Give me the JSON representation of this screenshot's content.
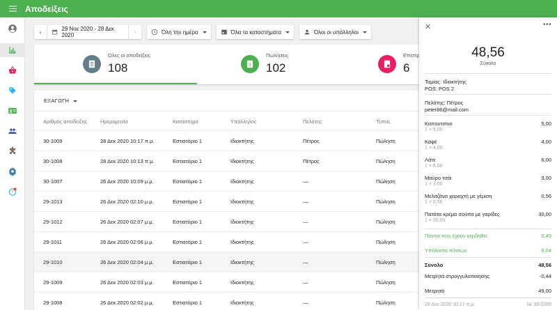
{
  "app": {
    "title": "Αποδείξεις"
  },
  "filters": {
    "date_range": "29 Νοε 2020 - 28 Δεκ 2020",
    "time": "Όλη την ημέρα",
    "stores": "Όλα τα καταστήματα",
    "employees": "Όλοι οι υπάλληλοι"
  },
  "summary": [
    {
      "label": "Όλες οι αποδείξεις",
      "value": "108",
      "color": "#607d8b"
    },
    {
      "label": "Πωλήσεις",
      "value": "102",
      "color": "#4caf50"
    },
    {
      "label": "Επιστρ",
      "value": "6",
      "color": "#e91e63"
    }
  ],
  "table": {
    "export_label": "ΕΞΑΓΩΓΗ",
    "headers": [
      "Αριθμός απόδειξης",
      "Ημερομηνία",
      "Κατάστημα",
      "Υπάλληλος",
      "Πελάτης",
      "Τύπος"
    ],
    "rows": [
      [
        "30-1009",
        "28 Δεκ 2020 10:17 π.μ.",
        "Εστιατόριο 1",
        "Ιδιοκτήτης",
        "Πέτρος",
        "Πώληση"
      ],
      [
        "30-1008",
        "28 Δεκ 2020 10:13 π.μ.",
        "Εστιατόριο 1",
        "Ιδιοκτήτης",
        "Πέτρος",
        "Πώληση"
      ],
      [
        "30-1007",
        "26 Δεκ 2020 10:09 μ.μ.",
        "Εστιατόριο 1",
        "Ιδιοκτήτης",
        "—",
        "Πώληση"
      ],
      [
        "29-1013",
        "26 Δεκ 2020 02:10 μ.μ.",
        "Εστιατόριο 1",
        "Ιδιοκτήτης",
        "—",
        "Πώληση"
      ],
      [
        "29-1012",
        "26 Δεκ 2020 02:07 μ.μ.",
        "Εστιατόριο 1",
        "Ιδιοκτήτης",
        "—",
        "Πώληση"
      ],
      [
        "29-1011",
        "26 Δεκ 2020 02:06 μ.μ.",
        "Εστιατόριο 1",
        "Ιδιοκτήτης",
        "—",
        "Πώληση"
      ],
      [
        "29-1010",
        "26 Δεκ 2020 02:04 μ.μ.",
        "Εστιατόριο 1",
        "Ιδιοκτήτης",
        "—",
        "Πώληση"
      ],
      [
        "29-1009",
        "26 Δεκ 2020 02:03 μ.μ.",
        "Εστιατόριο 1",
        "Ιδιοκτήτης",
        "—",
        "Πώληση"
      ],
      [
        "29-1008",
        "26 Δεκ 2020 02:02 μ.μ.",
        "Εστιατόριο 1",
        "Ιδιοκτήτης",
        "—",
        "Πώληση"
      ]
    ]
  },
  "receipt": {
    "total": "48,56",
    "total_label": "Σύνολο",
    "cashier": "Ταμίας: Ιδιοκτήτης",
    "pos": "POS: POS 2",
    "customer": "Πελάτης: Πέτρος",
    "email": "peter86@mail.com",
    "items": [
      {
        "name": "Καπουτσίνο",
        "qty": "1 × 5,00",
        "price": "5,00"
      },
      {
        "name": "Καφέ",
        "qty": "1 × 4,00",
        "price": "4,00"
      },
      {
        "name": "Λάτε",
        "qty": "1 × 6,00",
        "price": "6,00"
      },
      {
        "name": "Μαύρο τσάι",
        "qty": "1 × 3,00",
        "price": "3,00"
      },
      {
        "name": "Μελιτζάνα χαραχτή με γέμιση",
        "qty": "1 × 0,56",
        "price": "0,56"
      },
      {
        "name": "Πατάτα κρέμα σούπα με γαρίδες",
        "qty": "1 × 30,00",
        "price": "30,00"
      }
    ],
    "points_earned_label": "Πόντοι που έχουν κερδηθεί",
    "points_earned": "0,49",
    "points_balance_label": "Υπόλοιπο πόντων",
    "points_balance": "6,04",
    "sum_label": "Σύνολο",
    "sum_value": "48,56",
    "rounding_label": "Μετρητά στρογγυλοποίησης",
    "rounding_value": "-0,44",
    "cash_label": "Μετρητά",
    "cash_value": "49,00",
    "footer_date": "28 Δεκ 2020 10:17 π.μ.",
    "footer_no": "№ 30-1009"
  }
}
